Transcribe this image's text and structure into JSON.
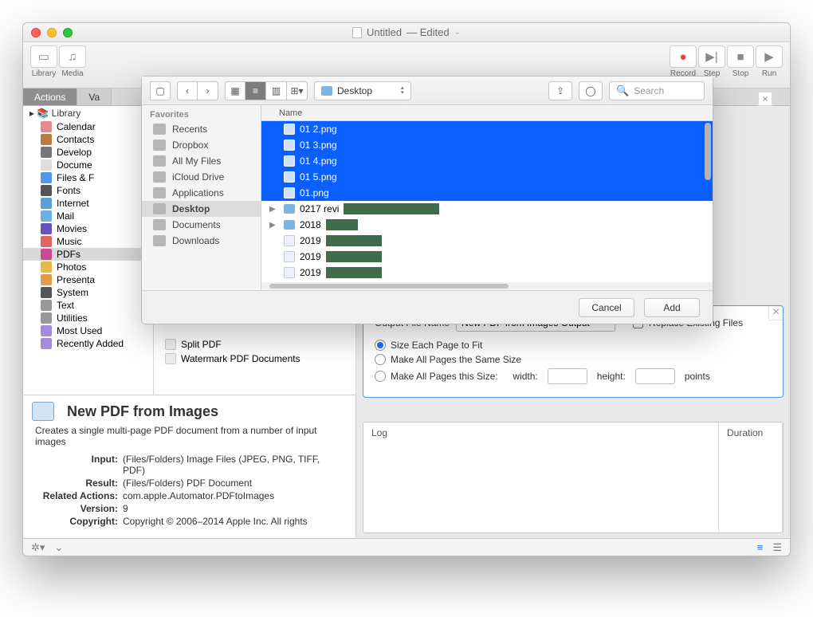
{
  "window": {
    "title": "Untitled",
    "status": "Edited"
  },
  "toolbar": {
    "library": "Library",
    "media": "Media",
    "record": "Record",
    "step": "Step",
    "stop": "Stop",
    "run": "Run"
  },
  "tabs": {
    "actions": "Actions",
    "variables": "Va"
  },
  "library": {
    "root": "Library",
    "items": [
      "Calendar",
      "Contacts",
      "Develop",
      "Docume",
      "Files & F",
      "Fonts",
      "Internet",
      "Mail",
      "Movies",
      "Music",
      "PDFs",
      "Photos",
      "Presenta",
      "System",
      "Text",
      "Utilities",
      "Most Used",
      "Recently Added"
    ],
    "selected_index": 10
  },
  "mid_actions": [
    "Split PDF",
    "Watermark PDF Documents"
  ],
  "action_card": {
    "ofn_label": "Output File Name",
    "ofn_value": "New PDF from Images Output",
    "replace": "Replace Existing Files",
    "r1": "Size Each Page to Fit",
    "r2": "Make All Pages the Same Size",
    "r3": "Make All Pages this Size:",
    "width": "width:",
    "height": "height:",
    "units": "points"
  },
  "info": {
    "title": "New PDF from Images",
    "desc": "Creates a single multi-page PDF document from a number of input images",
    "rows": [
      {
        "k": "Input:",
        "v": "(Files/Folders) Image Files (JPEG, PNG, TIFF, PDF)"
      },
      {
        "k": "Result:",
        "v": "(Files/Folders) PDF Document"
      },
      {
        "k": "Related Actions:",
        "v": "com.apple.Automator.PDFtoImages"
      },
      {
        "k": "Version:",
        "v": "9"
      },
      {
        "k": "Copyright:",
        "v": "Copyright © 2006–2014 Apple Inc. All rights"
      }
    ]
  },
  "log": {
    "col1": "Log",
    "col2": "Duration"
  },
  "sheet": {
    "location": "Desktop",
    "search_placeholder": "Search",
    "favorites_title": "Favorites",
    "favorites": [
      "Recents",
      "Dropbox",
      "All My Files",
      "iCloud Drive",
      "Applications",
      "Desktop",
      "Documents",
      "Downloads"
    ],
    "favorites_selected_index": 5,
    "header": "Name",
    "files_selected": [
      "01 2.png",
      "01 3.png",
      "01 4.png",
      "01 5.png",
      "01.png"
    ],
    "folders": [
      "0217 revi",
      "2018"
    ],
    "docs": [
      "2019",
      "2019",
      "2019"
    ],
    "cancel": "Cancel",
    "add": "Add"
  }
}
